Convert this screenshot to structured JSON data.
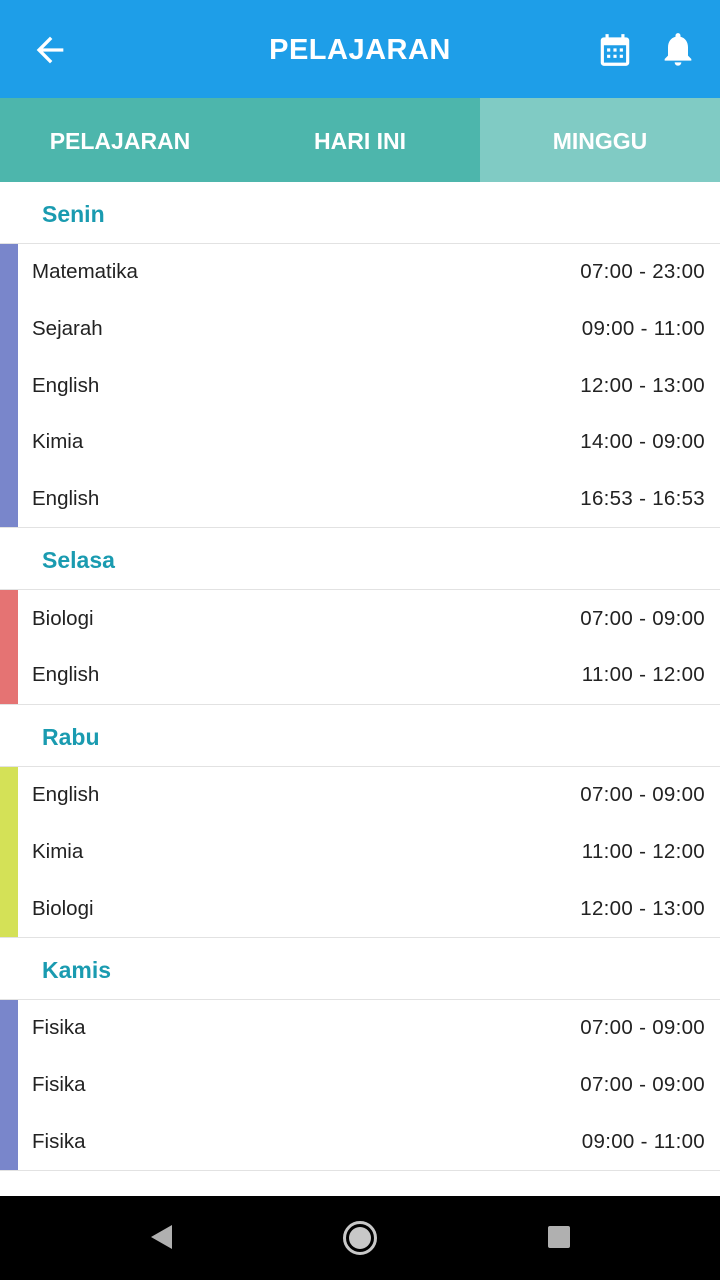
{
  "appbar": {
    "title": "PELAJARAN",
    "color": "#1e9ee8"
  },
  "tabs": [
    {
      "label": "PELAJARAN",
      "active": false
    },
    {
      "label": "HARI INI",
      "active": false
    },
    {
      "label": "MINGGU",
      "active": true
    }
  ],
  "days": [
    {
      "name": "Senin",
      "color": "#7986cb",
      "lessons": [
        {
          "subject": "Matematika",
          "time": "07:00 - 23:00"
        },
        {
          "subject": "Sejarah",
          "time": "09:00 - 11:00"
        },
        {
          "subject": "English",
          "time": "12:00 - 13:00"
        },
        {
          "subject": "Kimia",
          "time": "14:00 - 09:00"
        },
        {
          "subject": "English",
          "time": "16:53 - 16:53"
        }
      ]
    },
    {
      "name": "Selasa",
      "color": "#e57373",
      "lessons": [
        {
          "subject": "Biologi",
          "time": "07:00 - 09:00"
        },
        {
          "subject": "English",
          "time": "11:00 - 12:00"
        }
      ]
    },
    {
      "name": "Rabu",
      "color": "#d4e157",
      "lessons": [
        {
          "subject": "English",
          "time": "07:00 - 09:00"
        },
        {
          "subject": "Kimia",
          "time": "11:00 - 12:00"
        },
        {
          "subject": "Biologi",
          "time": "12:00 - 13:00"
        }
      ]
    },
    {
      "name": "Kamis",
      "color": "#7986cb",
      "lessons": [
        {
          "subject": "Fisika",
          "time": "07:00 - 09:00"
        },
        {
          "subject": "Fisika",
          "time": "07:00 - 09:00"
        },
        {
          "subject": "Fisika",
          "time": "09:00 - 11:00"
        }
      ]
    }
  ],
  "icons": {
    "back": "arrow-back-icon",
    "calendar": "calendar-icon",
    "notifications": "bell-icon",
    "nav_back": "triangle-back-icon",
    "nav_home": "circle-home-icon",
    "nav_recents": "square-recents-icon"
  }
}
